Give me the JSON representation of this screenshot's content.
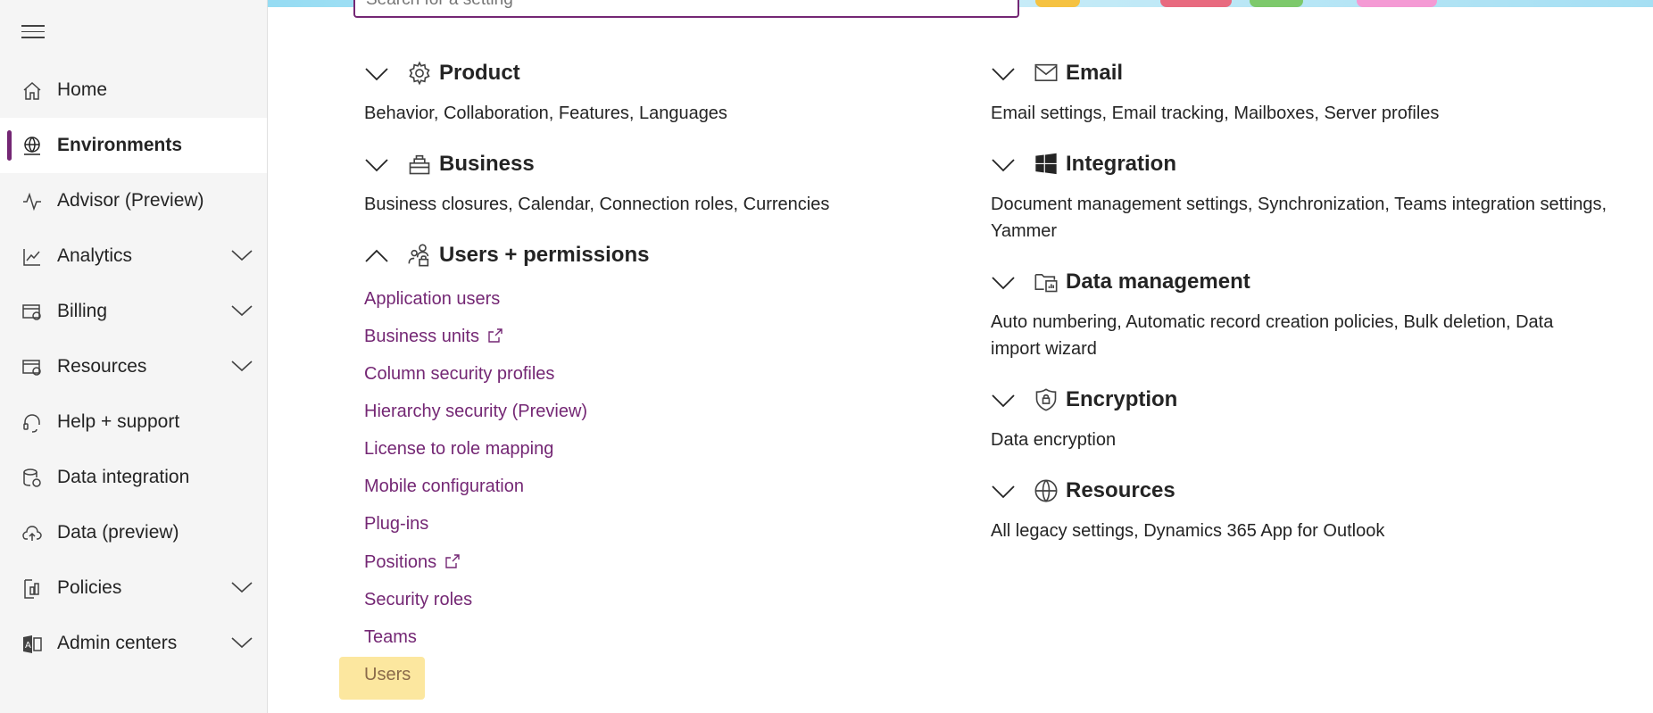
{
  "search": {
    "placeholder": "Search for a setting"
  },
  "sidebar": {
    "items": [
      {
        "label": "Home",
        "icon": "home-icon"
      },
      {
        "label": "Environments",
        "icon": "globe-icon",
        "active": true
      },
      {
        "label": "Advisor (Preview)",
        "icon": "pulse-icon"
      },
      {
        "label": "Analytics",
        "icon": "chart-icon",
        "expandable": true
      },
      {
        "label": "Billing",
        "icon": "billing-icon",
        "expandable": true
      },
      {
        "label": "Resources",
        "icon": "resources-icon",
        "expandable": true
      },
      {
        "label": "Help + support",
        "icon": "headset-icon"
      },
      {
        "label": "Data integration",
        "icon": "database-icon"
      },
      {
        "label": "Data (preview)",
        "icon": "cloud-upload-icon"
      },
      {
        "label": "Policies",
        "icon": "policy-icon",
        "expandable": true
      },
      {
        "label": "Admin centers",
        "icon": "admin-icon",
        "expandable": true
      }
    ]
  },
  "left_sections": [
    {
      "title": "Product",
      "icon": "gear-icon",
      "expanded": false,
      "desc": "Behavior, Collaboration, Features, Languages"
    },
    {
      "title": "Business",
      "icon": "business-icon",
      "expanded": false,
      "desc": "Business closures, Calendar, Connection roles, Currencies"
    },
    {
      "title": "Users + permissions",
      "icon": "users-lock-icon",
      "expanded": true,
      "links": [
        {
          "label": "Application users"
        },
        {
          "label": "Business units",
          "external": true
        },
        {
          "label": "Column security profiles"
        },
        {
          "label": "Hierarchy security (Preview)"
        },
        {
          "label": "License to role mapping"
        },
        {
          "label": "Mobile configuration"
        },
        {
          "label": "Plug-ins"
        },
        {
          "label": "Positions",
          "external": true
        },
        {
          "label": "Security roles"
        },
        {
          "label": "Teams"
        },
        {
          "label": "Users",
          "highlighted": true
        }
      ]
    }
  ],
  "right_sections": [
    {
      "title": "Email",
      "icon": "mail-icon",
      "desc": "Email settings, Email tracking, Mailboxes, Server profiles"
    },
    {
      "title": "Integration",
      "icon": "windows-icon",
      "desc": "Document management settings, Synchronization, Teams integration settings, Yammer"
    },
    {
      "title": "Data management",
      "icon": "data-management-icon",
      "desc": "Auto numbering, Automatic record creation policies, Bulk deletion, Data import wizard"
    },
    {
      "title": "Encryption",
      "icon": "shield-lock-icon",
      "desc": "Data encryption"
    },
    {
      "title": "Resources",
      "icon": "globe-icon",
      "desc": "All legacy settings, Dynamics 365 App for Outlook"
    }
  ],
  "colors": {
    "accent": "#742774",
    "highlight": "#fbe38e"
  }
}
